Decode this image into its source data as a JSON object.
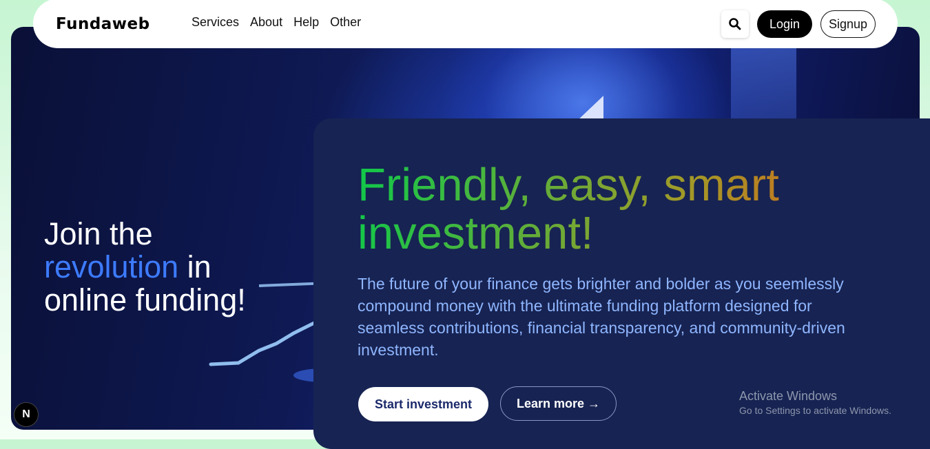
{
  "brand": {
    "logo": "Fundaweb"
  },
  "nav": {
    "links": [
      "Services",
      "About",
      "Help",
      "Other"
    ],
    "search_icon": "search-icon",
    "login_label": "Login",
    "signup_label": "Signup"
  },
  "hero": {
    "join_line1": "Join the",
    "join_accent": "revolution",
    "join_line2_rest": " in",
    "join_line3": "online funding!"
  },
  "card": {
    "headline": "Friendly, easy, smart investment!",
    "lead": "The future of your finance gets brighter and bolder as you seemlessly compound money with the ultimate funding platform designed for seamless contributions, financial transparency, and community-driven investment.",
    "start_label": "Start investment",
    "learn_label": "Learn more →"
  },
  "watermark": {
    "line1": "Activate Windows",
    "line2": "Go to Settings to activate Windows."
  },
  "dev_badge": {
    "label": "N"
  },
  "colors": {
    "accent_blue": "#3d7bff",
    "card_bg": "#172352",
    "gradient_start": "#10c84a",
    "gradient_end": "#d4631a"
  }
}
